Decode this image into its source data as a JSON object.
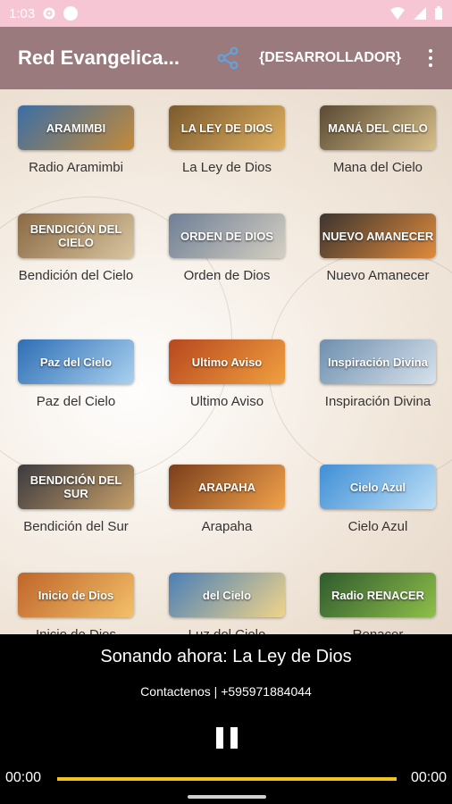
{
  "status_bar": {
    "time": "1:03"
  },
  "toolbar": {
    "title": "Red Evangelica...",
    "developer_label": "{DESARROLLADOR}"
  },
  "stations": [
    {
      "label": "Radio Aramimbi",
      "thumb_text": "ARAMIMBI",
      "colors": [
        "#3b6ea5",
        "#c48a3a"
      ]
    },
    {
      "label": "La Ley de Dios",
      "thumb_text": "LA LEY DE DIOS",
      "colors": [
        "#7b5a2e",
        "#e0b060"
      ]
    },
    {
      "label": "Mana del Cielo",
      "thumb_text": "MANÁ DEL CIELO",
      "colors": [
        "#5a4a34",
        "#d8c08a"
      ]
    },
    {
      "label": "Bendición del Cielo",
      "thumb_text": "BENDICIÓN DEL CIELO",
      "colors": [
        "#8a6a44",
        "#d9c4a0"
      ]
    },
    {
      "label": "Orden de Dios",
      "thumb_text": "ORDEN DE DIOS",
      "colors": [
        "#6e7f96",
        "#d5cfc2"
      ]
    },
    {
      "label": "Nuevo Amanecer",
      "thumb_text": "NUEVO AMANECER",
      "colors": [
        "#3c3530",
        "#e08a3c"
      ]
    },
    {
      "label": "Paz del Cielo",
      "thumb_text": "Paz del Cielo",
      "colors": [
        "#2f6fb5",
        "#a9d0f0"
      ]
    },
    {
      "label": "Ultimo Aviso",
      "thumb_text": "Ultimo Aviso",
      "colors": [
        "#b8471f",
        "#f0a040"
      ]
    },
    {
      "label": "Inspiración Divina",
      "thumb_text": "Inspiración Divina",
      "colors": [
        "#6f8fae",
        "#d7e2ec"
      ]
    },
    {
      "label": "Bendición del Sur",
      "thumb_text": "BENDICIÓN DEL SUR",
      "colors": [
        "#3b3a3f",
        "#c8a06a"
      ]
    },
    {
      "label": "Arapaha",
      "thumb_text": "ARAPAHA",
      "colors": [
        "#7a3e1c",
        "#f2a24a"
      ]
    },
    {
      "label": "Cielo Azul",
      "thumb_text": "Cielo Azul",
      "colors": [
        "#3f8fd6",
        "#bfe0f7"
      ]
    },
    {
      "label": "Inicio de Dios",
      "thumb_text": "Inicio de Dios",
      "colors": [
        "#c0652a",
        "#f3c06a"
      ]
    },
    {
      "label": "Luz del Cielo",
      "thumb_text": "del Cielo",
      "colors": [
        "#4a7fb8",
        "#f0d48a"
      ]
    },
    {
      "label": "Renacer",
      "thumb_text": "Radio RENACER",
      "colors": [
        "#2f5a2e",
        "#8fbf4a"
      ]
    }
  ],
  "player": {
    "now_playing": "Sonando ahora: La Ley de Dios",
    "contact": "Contactenos | +595971884044",
    "time_elapsed": "00:00",
    "time_total": "00:00"
  }
}
